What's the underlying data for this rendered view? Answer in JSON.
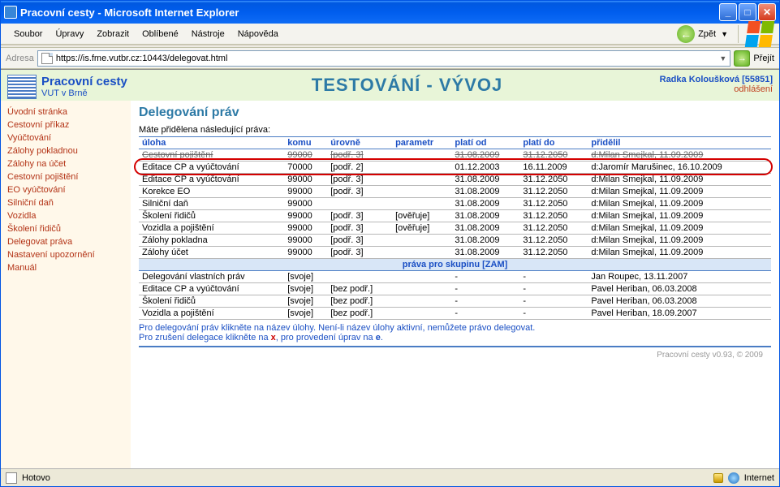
{
  "window": {
    "title": "Pracovní cesty - Microsoft Internet Explorer"
  },
  "menubar": {
    "items": [
      "Soubor",
      "Úpravy",
      "Zobrazit",
      "Oblíbené",
      "Nástroje",
      "Nápověda"
    ],
    "back": "Zpět"
  },
  "addressbar": {
    "label": "Adresa",
    "url": "https://is.fme.vutbr.cz:10443/delegovat.html",
    "go": "Přejít"
  },
  "banner": {
    "app_title": "Pracovní cesty",
    "subtitle": "VUT v Brně",
    "env": "TESTOVÁNÍ - VÝVOJ",
    "user": "Radka Koloušková [55851]",
    "logout": "odhlášení"
  },
  "sidebar": {
    "items": [
      "Úvodní stránka",
      "Cestovní příkaz",
      "Vyúčtování",
      "Zálohy pokladnou",
      "Zálohy na účet",
      "Cestovní pojištění",
      "EO vyúčtování",
      "Silniční daň",
      "Vozidla",
      "Školení řidičů",
      "Delegovat práva",
      "Nastavení upozornění",
      "Manuál"
    ]
  },
  "content": {
    "heading": "Delegování práv",
    "lead": "Máte přidělena následující práva:",
    "headers": [
      "úloha",
      "komu",
      "úrovně",
      "parametr",
      "platí od",
      "platí do",
      "přidělil"
    ],
    "rows": [
      {
        "struck": true,
        "c": [
          "Cestovní pojištění",
          "99000",
          "[podř. 3]",
          "",
          "31.08.2009",
          "31.12.2050",
          "d:Milan Smejkal, 11.09.2009"
        ]
      },
      {
        "hl": true,
        "c": [
          "Editace CP a vyúčtování",
          "70000",
          "[podř. 2]",
          "",
          "01.12.2003",
          "16.11.2009",
          "d:Jaromír Marušinec, 16.10.2009"
        ]
      },
      {
        "c": [
          "Editace CP a vyúčtování",
          "99000",
          "[podř. 3]",
          "",
          "31.08.2009",
          "31.12.2050",
          "d:Milan Smejkal, 11.09.2009"
        ]
      },
      {
        "c": [
          "Korekce EO",
          "99000",
          "[podř. 3]",
          "",
          "31.08.2009",
          "31.12.2050",
          "d:Milan Smejkal, 11.09.2009"
        ]
      },
      {
        "c": [
          "Silniční daň",
          "99000",
          "",
          "",
          "31.08.2009",
          "31.12.2050",
          "d:Milan Smejkal, 11.09.2009"
        ]
      },
      {
        "c": [
          "Školení řidičů",
          "99000",
          "[podř. 3]",
          "[ověřuje]",
          "31.08.2009",
          "31.12.2050",
          "d:Milan Smejkal, 11.09.2009"
        ]
      },
      {
        "c": [
          "Vozidla a pojištění",
          "99000",
          "[podř. 3]",
          "[ověřuje]",
          "31.08.2009",
          "31.12.2050",
          "d:Milan Smejkal, 11.09.2009"
        ]
      },
      {
        "c": [
          "Zálohy pokladna",
          "99000",
          "[podř. 3]",
          "",
          "31.08.2009",
          "31.12.2050",
          "d:Milan Smejkal, 11.09.2009"
        ]
      },
      {
        "c": [
          "Zálohy účet",
          "99000",
          "[podř. 3]",
          "",
          "31.08.2009",
          "31.12.2050",
          "d:Milan Smejkal, 11.09.2009"
        ]
      }
    ],
    "group_header": "práva pro skupinu [ZAM]",
    "group_rows": [
      {
        "c": [
          "Delegování vlastních práv",
          "[svoje]",
          "",
          "",
          "-",
          "-",
          "Jan Roupec, 13.11.2007"
        ]
      },
      {
        "c": [
          "Editace CP a vyúčtování",
          "[svoje]",
          "[bez podř.]",
          "",
          "-",
          "-",
          "Pavel Heriban, 06.03.2008"
        ]
      },
      {
        "c": [
          "Školení řidičů",
          "[svoje]",
          "[bez podř.]",
          "",
          "-",
          "-",
          "Pavel Heriban, 06.03.2008"
        ]
      },
      {
        "c": [
          "Vozidla a pojištění",
          "[svoje]",
          "[bez podř.]",
          "",
          "-",
          "-",
          "Pavel Heriban, 18.09.2007"
        ]
      }
    ],
    "hint1": "Pro delegování práv klikněte na název úlohy. Není-li název úlohy aktivní, nemůžete právo delegovat.",
    "hint2_a": "Pro zrušení delegace klikněte na ",
    "hint2_b": ", pro provedení úprav na ",
    "footer": "Pracovní cesty v0.93, © 2009"
  },
  "statusbar": {
    "status": "Hotovo",
    "zone": "Internet"
  }
}
